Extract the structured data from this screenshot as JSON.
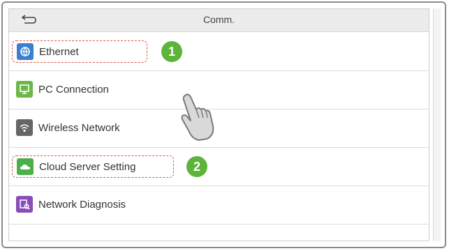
{
  "header": {
    "title": "Comm.",
    "back_icon": "back-arrow-icon"
  },
  "menu": {
    "items": [
      {
        "label": "Ethernet",
        "icon": "ethernet-icon",
        "icon_color": "#3a7fd0",
        "step": "1"
      },
      {
        "label": "PC Connection",
        "icon": "pc-connection-icon",
        "icon_color": "#6ab845"
      },
      {
        "label": "Wireless Network",
        "icon": "wireless-network-icon",
        "icon_color": "#666666"
      },
      {
        "label": "Cloud Server Setting",
        "icon": "cloud-server-icon",
        "icon_color": "#4caf4c",
        "step": "2"
      },
      {
        "label": "Network Diagnosis",
        "icon": "network-diagnosis-icon",
        "icon_color": "#8a4db8"
      }
    ]
  },
  "colors": {
    "step_badge": "#5cb53a",
    "highlight_border": "#e05a4a"
  }
}
